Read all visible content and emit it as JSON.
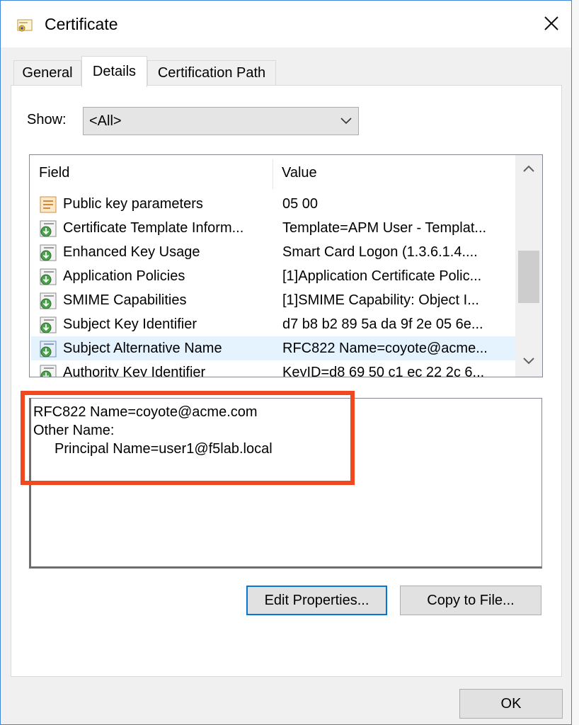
{
  "window": {
    "title": "Certificate",
    "close_glyph": "✕"
  },
  "tabs": [
    {
      "label": "General",
      "active": false
    },
    {
      "label": "Details",
      "active": true
    },
    {
      "label": "Certification Path",
      "active": false
    }
  ],
  "show": {
    "label": "Show:",
    "selected": "<All>"
  },
  "list": {
    "columns": [
      "Field",
      "Value"
    ],
    "rows": [
      {
        "field": "Public key parameters",
        "value": "05 00",
        "icon": "certificate-field-icon"
      },
      {
        "field": "Certificate Template Inform...",
        "value": "Template=APM User - Templat...",
        "icon": "extension-icon"
      },
      {
        "field": "Enhanced Key Usage",
        "value": "Smart Card Logon (1.3.6.1.4....",
        "icon": "extension-icon"
      },
      {
        "field": "Application Policies",
        "value": "[1]Application Certificate Polic...",
        "icon": "extension-icon"
      },
      {
        "field": "SMIME Capabilities",
        "value": "[1]SMIME Capability: Object I...",
        "icon": "extension-icon"
      },
      {
        "field": "Subject Key Identifier",
        "value": "d7 b8 b2 89 5a da 9f 2e 05 6e...",
        "icon": "extension-icon"
      },
      {
        "field": "Subject Alternative Name",
        "value": "RFC822 Name=coyote@acme...",
        "icon": "extension-icon",
        "selected": true
      },
      {
        "field": "Authority Key Identifier",
        "value": "KeyID=d8 69 50 c1 ec 22 2c 6...",
        "icon": "extension-icon"
      }
    ]
  },
  "detail": {
    "lines": [
      "RFC822 Name=coyote@acme.com",
      "Other Name:",
      "Principal Name=user1@f5lab.local"
    ]
  },
  "buttons": {
    "edit_properties": "Edit Properties...",
    "copy_to_file": "Copy to File...",
    "ok": "OK"
  },
  "colors": {
    "highlight_box": "#f1491f",
    "selected_row": "#e5f3ff",
    "focus_border": "#0078d7"
  }
}
